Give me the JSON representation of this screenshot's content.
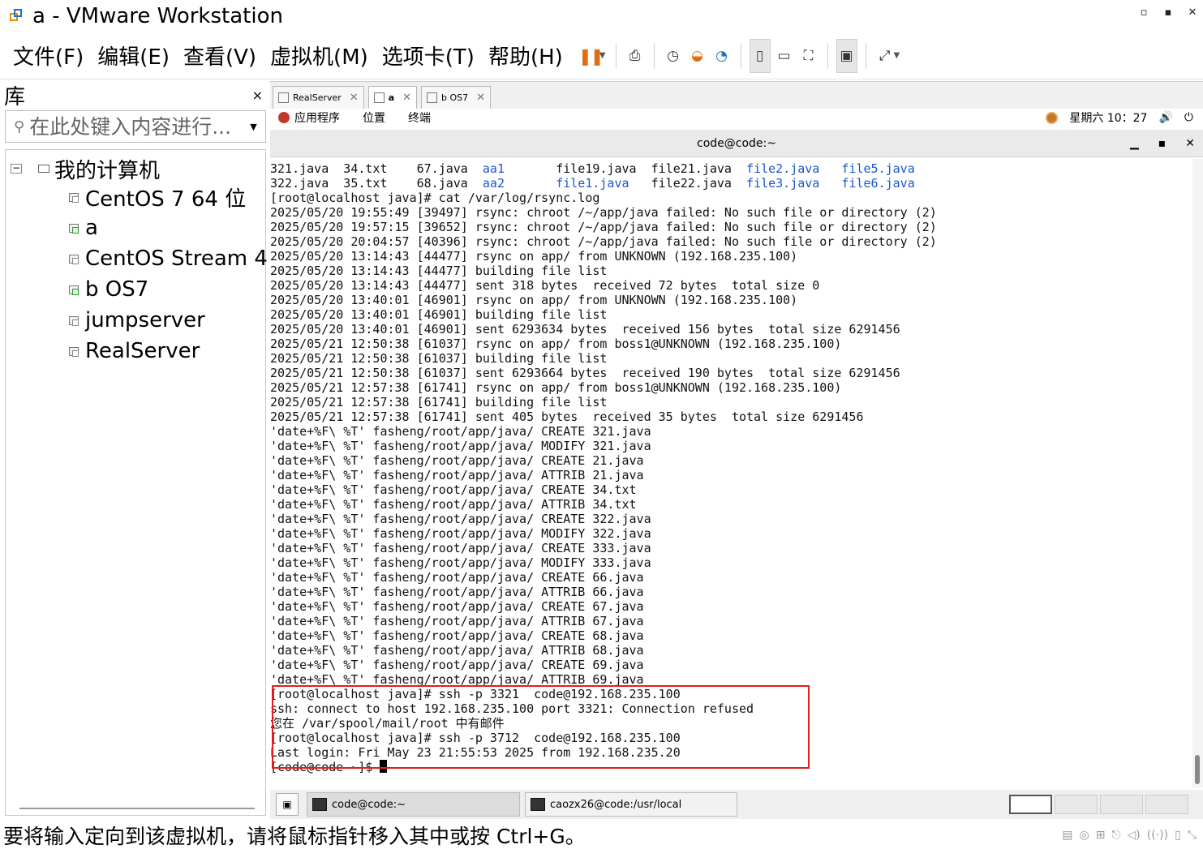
{
  "window": {
    "title": "a - VMware Workstation",
    "controls": [
      "▫",
      "▪",
      "✕"
    ]
  },
  "menu": [
    "文件(F)",
    "编辑(E)",
    "查看(V)",
    "虚拟机(M)",
    "选项卡(T)",
    "帮助(H)"
  ],
  "toolbar": {
    "pause": "❚❚",
    "icons": [
      "send-keys-icon",
      "snapshot-icon",
      "revert-snapshot-icon",
      "snapshot-manager-icon",
      "sidebar-view-icon",
      "console-view-icon",
      "fullscreen-icon",
      "terminal-icon",
      "unity-icon"
    ]
  },
  "library": {
    "title": "库",
    "close": "×",
    "search_placeholder": "在此处键入内容进行...",
    "root": "我的计算机",
    "items": [
      "CentOS 7 64 位",
      "a",
      "CentOS Stream 4",
      "b OS7",
      "jumpserver",
      "RealServer"
    ]
  },
  "tabs": [
    {
      "label": "RealServer",
      "close": "✕"
    },
    {
      "label": "a",
      "close": "✕"
    },
    {
      "label": "b OS7",
      "close": "✕"
    }
  ],
  "gnome": {
    "applications": "应用程序",
    "places": "位置",
    "terminal": "终端",
    "clock": "星期六 10：27"
  },
  "terminal_window": {
    "title": "code@code:~",
    "min": "▁",
    "max": "▪",
    "close": "✕"
  },
  "terminal": {
    "listing": [
      [
        "321.java  34.txt    67.java  ",
        "aa1      ",
        " file19.java  file21.java  ",
        "file2.java   file5.java"
      ],
      [
        "322.java  35.txt    68.java  ",
        "aa2      ",
        " ",
        "file1.java",
        "   file22.java  ",
        "file3.java   file6.java"
      ]
    ],
    "lines": [
      "[root@localhost java]# cat /var/log/rsync.log",
      "2025/05/20 19:55:49 [39497] rsync: chroot /~/app/java failed: No such file or directory (2)",
      "2025/05/20 19:57:15 [39652] rsync: chroot /~/app/java failed: No such file or directory (2)",
      "2025/05/20 20:04:57 [40396] rsync: chroot /~/app/java failed: No such file or directory (2)",
      "2025/05/20 13:14:43 [44477] rsync on app/ from UNKNOWN (192.168.235.100)",
      "2025/05/20 13:14:43 [44477] building file list",
      "2025/05/20 13:14:43 [44477] sent 318 bytes  received 72 bytes  total size 0",
      "2025/05/20 13:40:01 [46901] rsync on app/ from UNKNOWN (192.168.235.100)",
      "2025/05/20 13:40:01 [46901] building file list",
      "2025/05/20 13:40:01 [46901] sent 6293634 bytes  received 156 bytes  total size 6291456",
      "2025/05/21 12:50:38 [61037] rsync on app/ from boss1@UNKNOWN (192.168.235.100)",
      "2025/05/21 12:50:38 [61037] building file list",
      "2025/05/21 12:50:38 [61037] sent 6293664 bytes  received 190 bytes  total size 6291456",
      "2025/05/21 12:57:38 [61741] rsync on app/ from boss1@UNKNOWN (192.168.235.100)",
      "2025/05/21 12:57:38 [61741] building file list",
      "2025/05/21 12:57:38 [61741] sent 405 bytes  received 35 bytes  total size 6291456",
      "'date+%F\\ %T' fasheng/root/app/java/ CREATE 321.java",
      "'date+%F\\ %T' fasheng/root/app/java/ MODIFY 321.java",
      "'date+%F\\ %T' fasheng/root/app/java/ CREATE 21.java",
      "'date+%F\\ %T' fasheng/root/app/java/ ATTRIB 21.java",
      "'date+%F\\ %T' fasheng/root/app/java/ CREATE 34.txt",
      "'date+%F\\ %T' fasheng/root/app/java/ ATTRIB 34.txt",
      "'date+%F\\ %T' fasheng/root/app/java/ CREATE 322.java",
      "'date+%F\\ %T' fasheng/root/app/java/ MODIFY 322.java",
      "'date+%F\\ %T' fasheng/root/app/java/ CREATE 333.java",
      "'date+%F\\ %T' fasheng/root/app/java/ MODIFY 333.java",
      "'date+%F\\ %T' fasheng/root/app/java/ CREATE 66.java",
      "'date+%F\\ %T' fasheng/root/app/java/ ATTRIB 66.java",
      "'date+%F\\ %T' fasheng/root/app/java/ CREATE 67.java",
      "'date+%F\\ %T' fasheng/root/app/java/ ATTRIB 67.java",
      "'date+%F\\ %T' fasheng/root/app/java/ CREATE 68.java",
      "'date+%F\\ %T' fasheng/root/app/java/ ATTRIB 68.java",
      "'date+%F\\ %T' fasheng/root/app/java/ CREATE 69.java",
      "'date+%F\\ %T' fasheng/root/app/java/ ATTRIB 69.java",
      "[root@localhost java]# ssh -p 3321  code@192.168.235.100",
      "ssh: connect to host 192.168.235.100 port 3321: Connection refused",
      "您在 /var/spool/mail/root 中有邮件",
      "[root@localhost java]# ssh -p 3712  code@192.168.235.100",
      "Last login: Fri May 23 21:55:53 2025 from 192.168.235.20",
      "[code@code ~]$ "
    ]
  },
  "taskbar": {
    "tasks": [
      "code@code:~",
      "caozx26@code:/usr/local"
    ]
  },
  "status": {
    "message": "要将输入定向到该虚拟机，请将鼠标指针移入其中或按 Ctrl+G。"
  }
}
